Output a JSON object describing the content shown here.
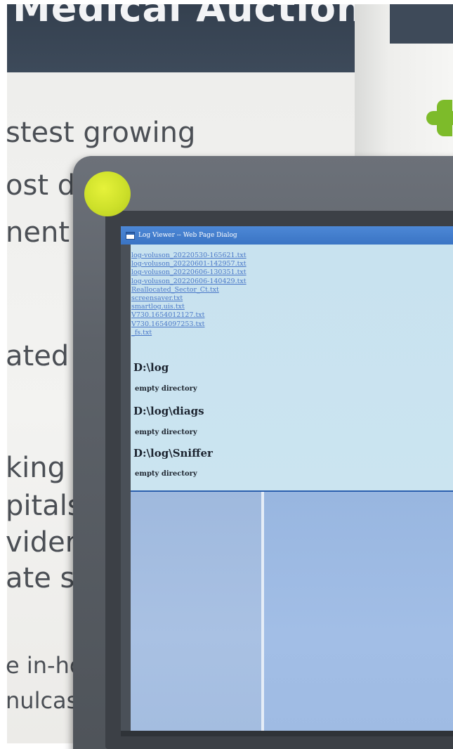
{
  "poster": {
    "banner_text": "Medical Auctions",
    "lines": [
      "stest growing",
      "ost dy",
      "nent",
      "ated",
      "king w",
      "pitals a",
      "viders",
      "ate se",
      "e in-ho",
      "nulcast"
    ]
  },
  "colors": {
    "poster_banner": "#34404f",
    "logo_cross": "#7dbb2a",
    "sticker": "#d4e32e",
    "titlebar": "#3a74c4",
    "link": "#4a78c8"
  },
  "dialog": {
    "title": "Log Viewer -- Web Page Dialog",
    "files": [
      "log-voluson_20220530-165621.txt",
      "log-voluson_20220601-142957.txt",
      "log-voluson_20220606-130351.txt",
      "log-voluson_20220606-140429.txt",
      "Reallocated_Sector_Ct.txt",
      "screensaver.txt",
      "smartlog.uis.txt",
      "V730.1654012127.txt",
      "V730.1654097253.txt",
      "_fs.txt"
    ],
    "directories": [
      {
        "path": "D:\\log",
        "note": "empty directory"
      },
      {
        "path": "D:\\log\\diags",
        "note": "empty directory"
      },
      {
        "path": "D:\\log\\Sniffer",
        "note": "empty directory"
      }
    ]
  }
}
